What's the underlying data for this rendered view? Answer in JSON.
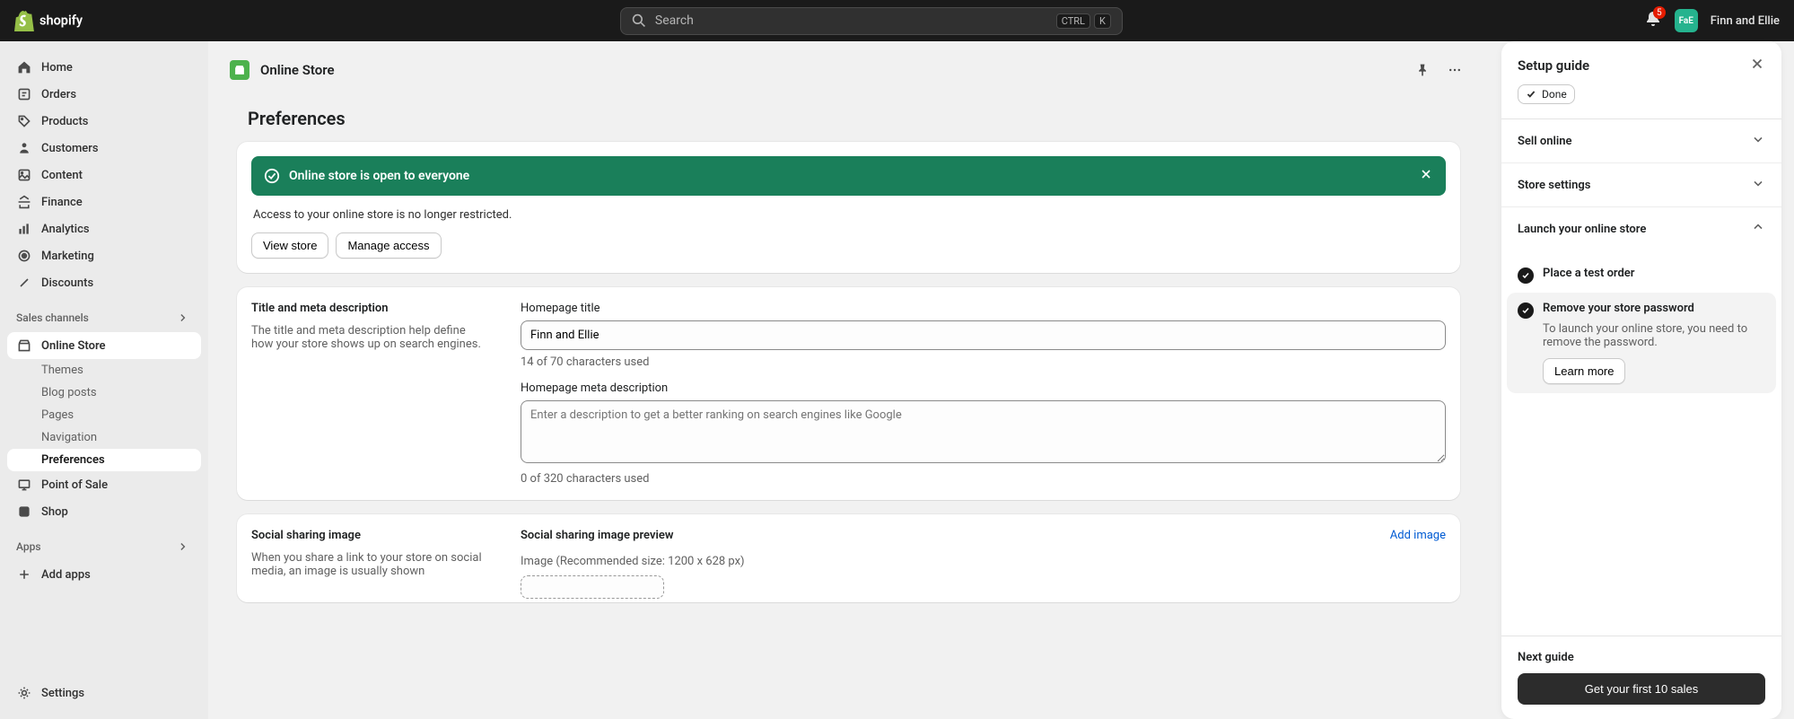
{
  "topbar": {
    "search_placeholder": "Search",
    "kbd1": "CTRL",
    "kbd2": "K",
    "notification_count": "5",
    "avatar_initials": "FaE",
    "user_name": "Finn and Ellie"
  },
  "sidebar": {
    "items": [
      {
        "label": "Home"
      },
      {
        "label": "Orders"
      },
      {
        "label": "Products"
      },
      {
        "label": "Customers"
      },
      {
        "label": "Content"
      },
      {
        "label": "Finance"
      },
      {
        "label": "Analytics"
      },
      {
        "label": "Marketing"
      },
      {
        "label": "Discounts"
      }
    ],
    "sales_channels_header": "Sales channels",
    "online_store": "Online Store",
    "online_store_sub": [
      {
        "label": "Themes"
      },
      {
        "label": "Blog posts"
      },
      {
        "label": "Pages"
      },
      {
        "label": "Navigation"
      },
      {
        "label": "Preferences"
      }
    ],
    "pos": "Point of Sale",
    "shop": "Shop",
    "apps_header": "Apps",
    "add_apps": "Add apps",
    "settings": "Settings"
  },
  "page": {
    "breadcrumb": "Online Store",
    "title": "Preferences",
    "banner_text": "Online store is open to everyone",
    "banner_sub": "Access to your online store is no longer restricted.",
    "view_store": "View store",
    "manage_access": "Manage access",
    "section_title_desc": {
      "heading": "Title and meta description",
      "help": "The title and meta description help define how your store shows up on search engines."
    },
    "homepage_title_label": "Homepage title",
    "homepage_title_value": "Finn and Ellie",
    "homepage_title_help": "14 of 70 characters used",
    "homepage_meta_label": "Homepage meta description",
    "homepage_meta_placeholder": "Enter a description to get a better ranking on search engines like Google",
    "homepage_meta_help": "0 of 320 characters used",
    "social_heading": "Social sharing image",
    "social_help": "When you share a link to your store on social media, an image is usually shown",
    "social_preview_label": "Social sharing image preview",
    "add_image": "Add image",
    "image_hint": "Image (Recommended size: 1200 x 628 px)"
  },
  "setup": {
    "title": "Setup guide",
    "done_label": "Done",
    "rows": [
      {
        "label": "Sell online"
      },
      {
        "label": "Store settings"
      },
      {
        "label": "Launch your online store"
      }
    ],
    "task1": "Place a test order",
    "task2_title": "Remove your store password",
    "task2_desc": "To launch your online store, you need to remove the password.",
    "learn_more": "Learn more",
    "next_guide": "Next guide",
    "cta": "Get your first 10 sales"
  }
}
